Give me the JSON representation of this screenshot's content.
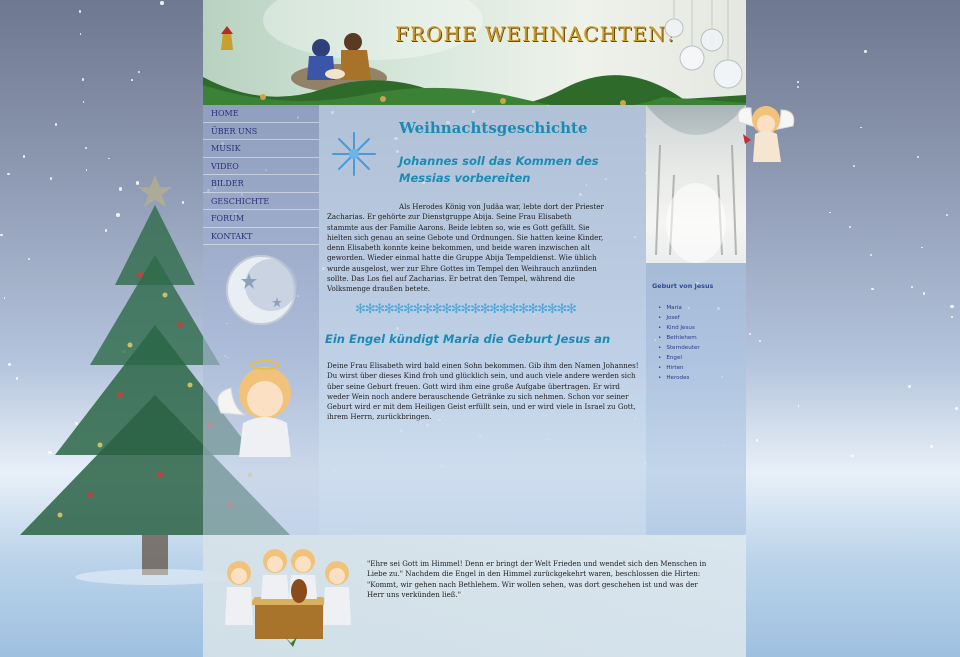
{
  "header": {
    "title": "FROHE WEIHNACHTEN!"
  },
  "nav": {
    "items": [
      {
        "label": "HOME"
      },
      {
        "label": "ÜBER UNS"
      },
      {
        "label": "MUSIK"
      },
      {
        "label": "VIDEO"
      },
      {
        "label": "BILDER"
      },
      {
        "label": "GESCHICHTE"
      },
      {
        "label": "FORUM"
      },
      {
        "label": "KONTAKT"
      }
    ]
  },
  "main": {
    "title": "Weihnachtsgeschichte",
    "subtitle1": "Johannes soll das Kommen des Messias vorbereiten",
    "paragraph1": "Als Herodes König von Judäa war, lebte dort der Priester Zacharias. Er gehörte zur Dienstgruppe Abija. Seine Frau Elisabeth stammte aus der Familie Aarons. Beide lebten so, wie es Gott gefällt. Sie hielten sich genau an seine Gebote und Ordnungen. Sie hatten keine Kinder, denn Elisabeth konnte keine bekommen, und beide waren inzwischen alt geworden. Wieder einmal hatte die Gruppe Abija Tempeldienst. Wie üblich wurde ausgelost, wer zur Ehre Gottes im Tempel den Weihrauch anzünden sollte. Das Los fiel auf Zacharias. Er betrat den Tempel, während die Volksmenge draußen betete.",
    "divider": "✻✻✻✻✻✻✻✻✻✻✻✻✻✻✻✻✻✻✻✻✻✻✻",
    "subtitle2": "Ein Engel kündigt Maria die Geburt Jesus an",
    "paragraph2": "Deine Frau Elisabeth wird bald einen Sohn bekommen. Gib ihm den Namen Johannes! Du wirst über dieses Kind froh und glücklich sein, und auch viele andere werden sich über seine Geburt freuen. Gott wird ihm eine große Aufgabe übertragen. Er wird weder Wein noch andere berauschende Getränke zu sich nehmen. Schon vor seiner Geburt wird er mit dem Heiligen Geist erfüllt sein, und er wird viele in Israel zu Gott, ihrem Herrn, zurückbringen."
  },
  "side": {
    "title": "Geburt von Jesus",
    "items": [
      "Maria",
      "Josef",
      "Kind Jesus",
      "Bethlehem",
      "Sterndeuter",
      "Engel",
      "Hirten",
      "Herodes"
    ]
  },
  "footer": {
    "quote": "\"Ehre sei Gott im Himmel! Denn er bringt der Welt Frieden und wendet sich den Menschen in Liebe zu.\" Nachdem die Engel in den Himmel zurückgekehrt waren, beschlossen die Hirten: \"Kommt, wir gehen nach Bethlehem. Wir wollen sehen, was dort geschehen ist und was der Herr uns verkünden ließ.\""
  },
  "colors": {
    "accent": "#1a8cb4",
    "nav_text": "#2b2e7a",
    "title_gold": "#c89a2c"
  }
}
